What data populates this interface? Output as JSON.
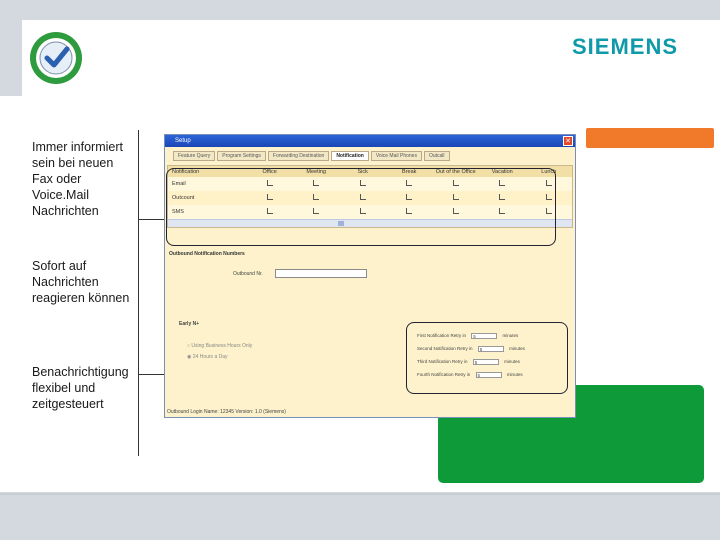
{
  "brand": {
    "logo_text": "SIEMENS",
    "brand_color": "#0f9aa9",
    "badge_icon": "check-seal-icon"
  },
  "captions": [
    "Immer informiert sein bei neuen Fax oder Voice.Mail Nachrichten",
    "Sofort auf Nachrichten reagieren können",
    "Benachrichtigung flexibel und zeitgesteuert"
  ],
  "accent": {
    "orange": "#f07a2a",
    "green": "#0f9a3a"
  },
  "window": {
    "title": "Setup",
    "close_glyph": "✕",
    "tabs": [
      "Feature Query",
      "Program Settings",
      "Forwarding Destination",
      "Notification",
      "Voice Mail Phones",
      "Outcall"
    ],
    "active_tab": "Notification",
    "columns": [
      "Notification",
      "Office",
      "Meeting",
      "Sick",
      "Break",
      "Out of the Office",
      "Vacation",
      "Lunch"
    ],
    "rows": [
      "Email",
      "Outcount",
      "SMS"
    ],
    "section_title": "Outbound Notification Numbers",
    "number_label": "Outbound Nr.",
    "retry_label": "Early N+",
    "radio_options": [
      "Using Business Hours Only",
      "24 Hours a Day"
    ],
    "attempts": [
      {
        "label": "First Notification Retry in",
        "value": "5",
        "unit": "minutes"
      },
      {
        "label": "Second Notification Retry in",
        "value": "5",
        "unit": "minutes"
      },
      {
        "label": "Third Notification Retry in",
        "value": "5",
        "unit": "minutes"
      },
      {
        "label": "Fourth Notification Retry in",
        "value": "5",
        "unit": "minutes"
      }
    ],
    "status_text": "Outbound Login Name: 12345   Version: 1.0 (Siemens)"
  }
}
